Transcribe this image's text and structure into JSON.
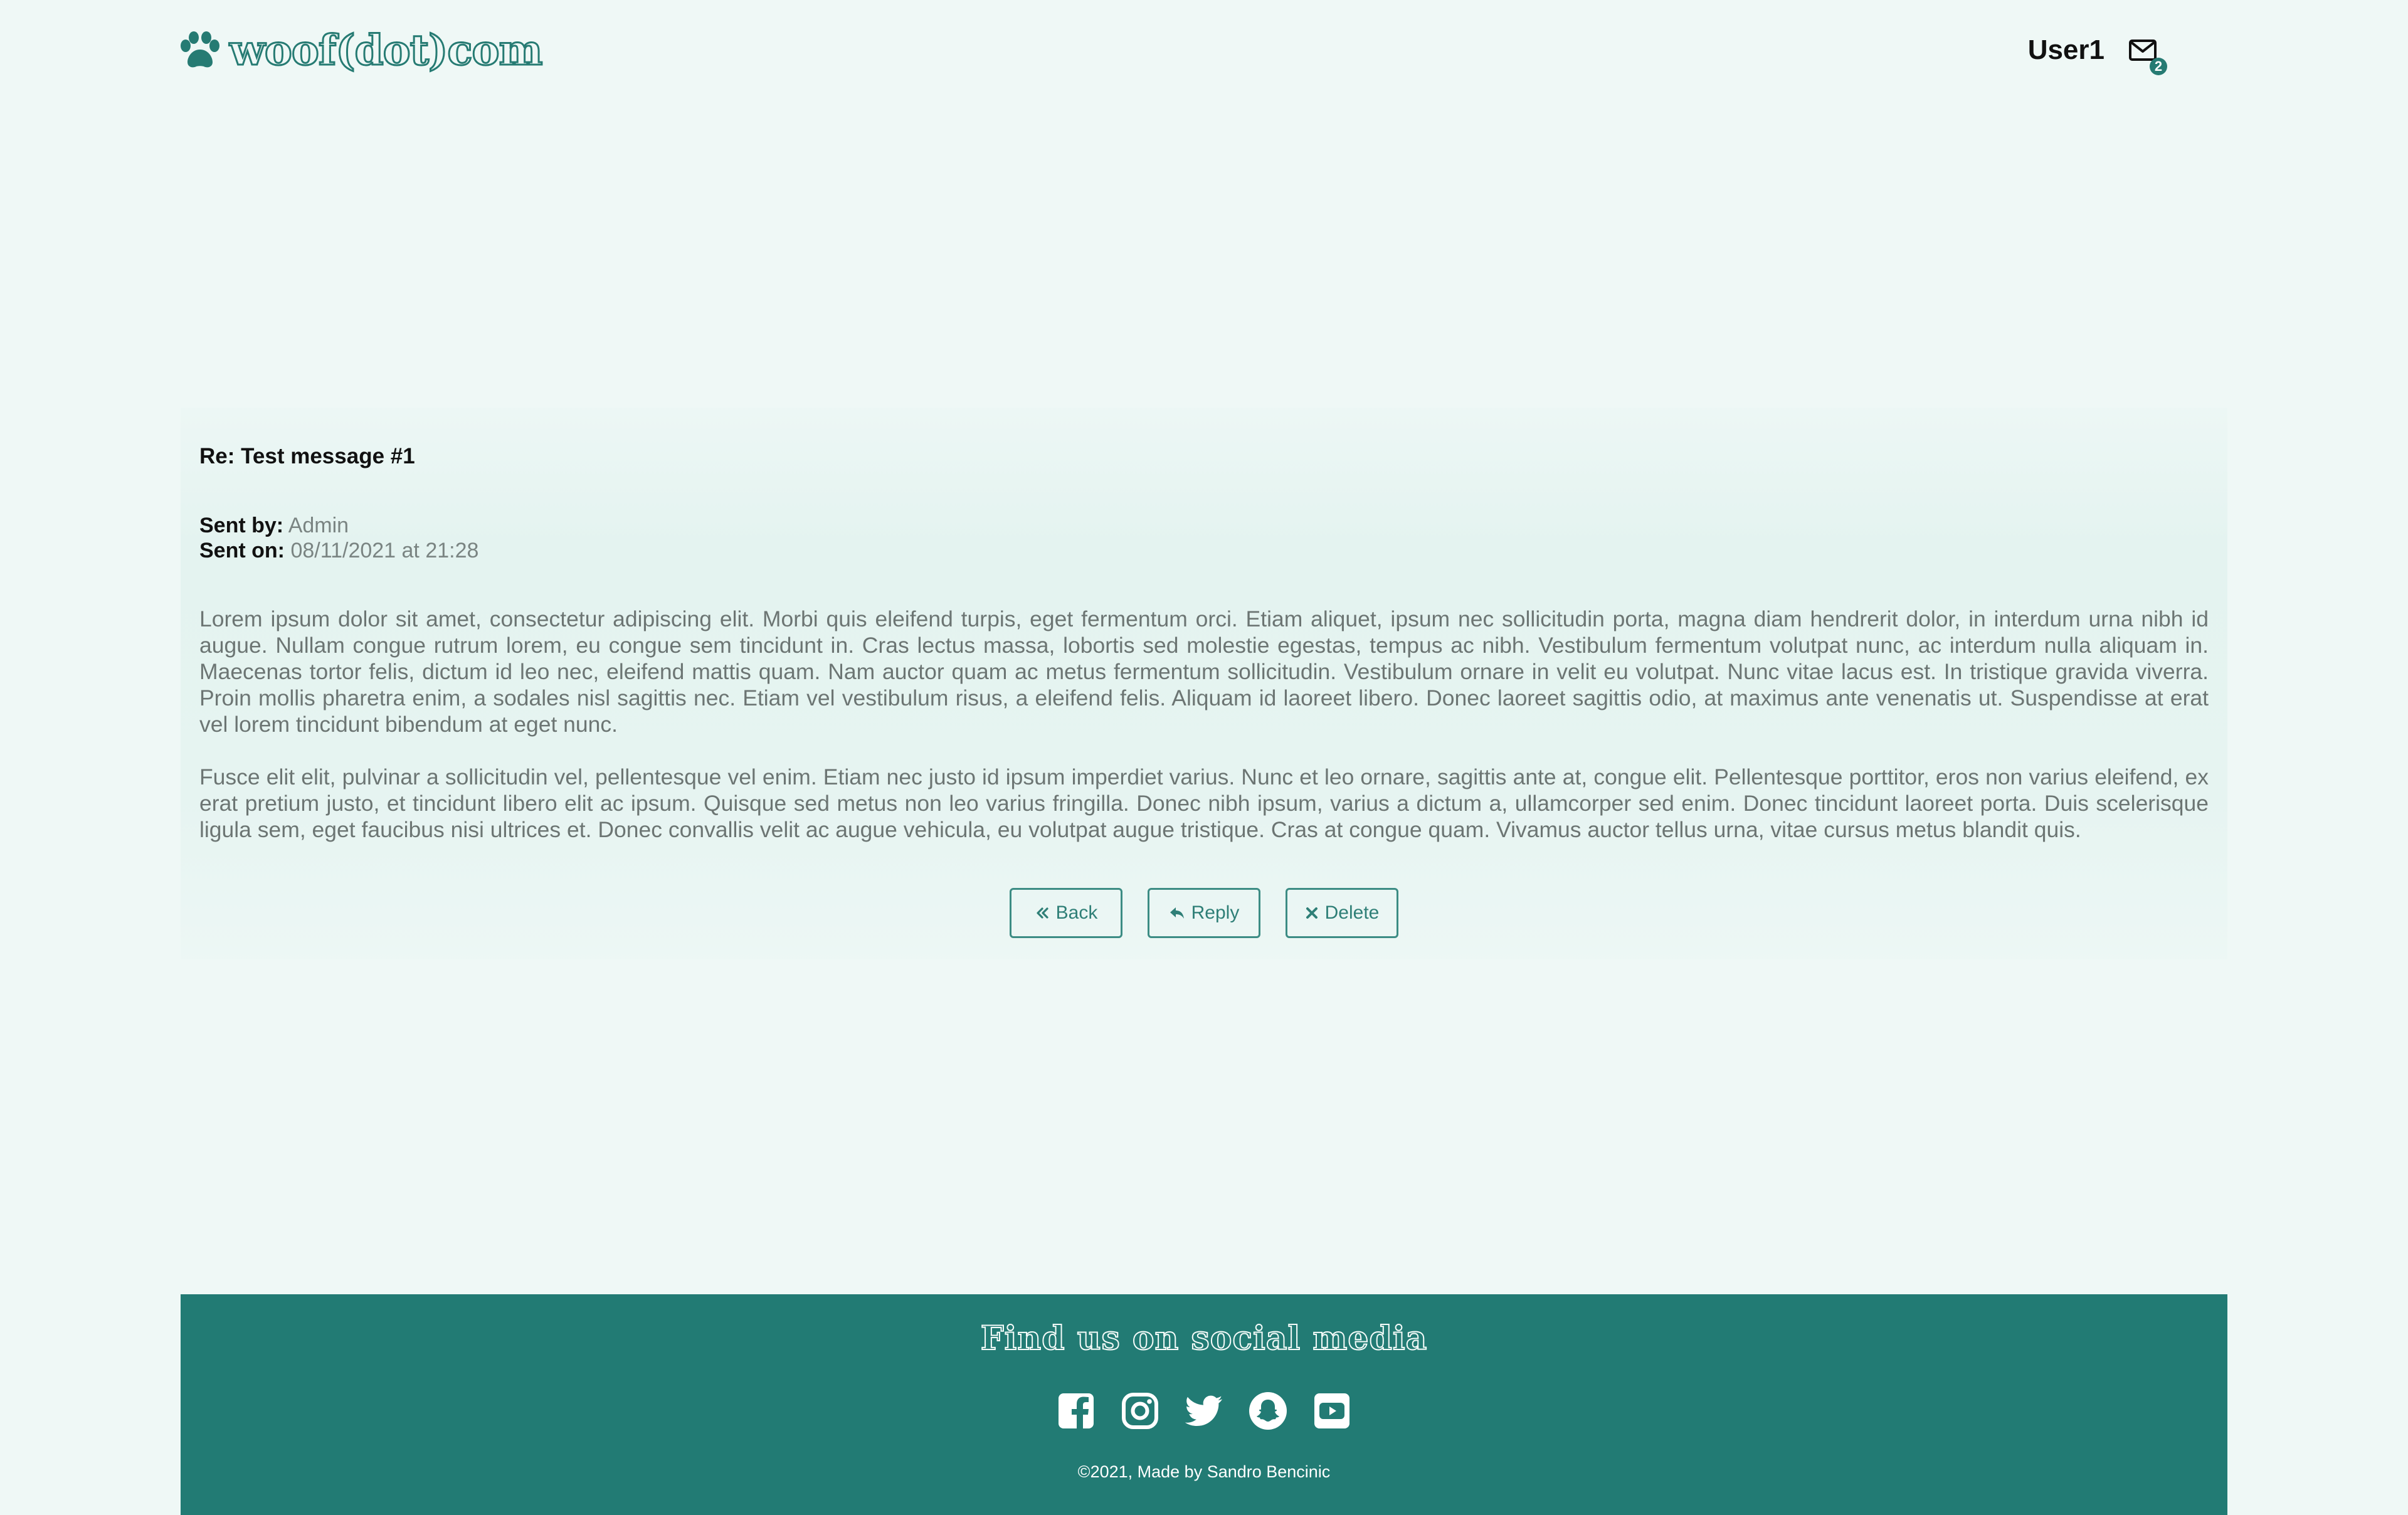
{
  "header": {
    "brand_text": "woof(dot)com",
    "brand_icon": "paw-icon",
    "username": "User1",
    "mail_icon": "envelope-icon",
    "unread_count": "2"
  },
  "message": {
    "subject": "Re: Test message #1",
    "sent_by_label": "Sent by:",
    "sent_by_value": "Admin",
    "sent_on_label": "Sent on:",
    "sent_on_value": "08/11/2021 at 21:28",
    "paragraphs": [
      "Lorem ipsum dolor sit amet, consectetur adipiscing elit. Morbi quis eleifend turpis, eget fermentum orci. Etiam aliquet, ipsum nec sollicitudin porta, magna diam hendrerit dolor, in interdum urna nibh id augue. Nullam congue rutrum lorem, eu congue sem tincidunt in. Cras lectus massa, lobortis sed molestie egestas, tempus ac nibh. Vestibulum fermentum volutpat nunc, ac interdum nulla aliquam in. Maecenas tortor felis, dictum id leo nec, eleifend mattis quam. Nam auctor quam ac metus fermentum sollicitudin. Vestibulum ornare in velit eu volutpat. Nunc vitae lacus est. In tristique gravida viverra. Proin mollis pharetra enim, a sodales nisl sagittis nec. Etiam vel vestibulum risus, a eleifend felis. Aliquam id laoreet libero. Donec laoreet sagittis odio, at maximus ante venenatis ut. Suspendisse at erat vel lorem tincidunt bibendum at eget nunc.",
      "Fusce elit elit, pulvinar a sollicitudin vel, pellentesque vel enim. Etiam nec justo id ipsum imperdiet varius. Nunc et leo ornare, sagittis ante at, congue elit. Pellentesque porttitor, eros non varius eleifend, ex erat pretium justo, et tincidunt libero elit ac ipsum. Quisque sed metus non leo varius fringilla. Donec nibh ipsum, varius a dictum a, ullamcorper sed enim. Donec tincidunt laoreet porta. Duis scelerisque ligula sem, eget faucibus nisi ultrices et. Donec convallis velit ac augue vehicula, eu volutpat augue tristique. Cras at congue quam. Vivamus auctor tellus urna, vitae cursus metus blandit quis."
    ],
    "actions": {
      "back_label": "Back",
      "back_icon": "angles-left-icon",
      "reply_label": "Reply",
      "reply_icon": "reply-arrow-icon",
      "delete_label": "Delete",
      "delete_icon": "close-icon"
    }
  },
  "footer": {
    "title": "Find us on social media",
    "social": [
      "facebook-icon",
      "instagram-icon",
      "twitter-icon",
      "snapchat-icon",
      "youtube-icon"
    ],
    "copyright": "©2021, Made by Sandro Bencinic"
  },
  "colors": {
    "page_background": "#eff8f6",
    "accent": "#267b73",
    "footer_background": "#227b74",
    "body_text": "#6c7573"
  }
}
